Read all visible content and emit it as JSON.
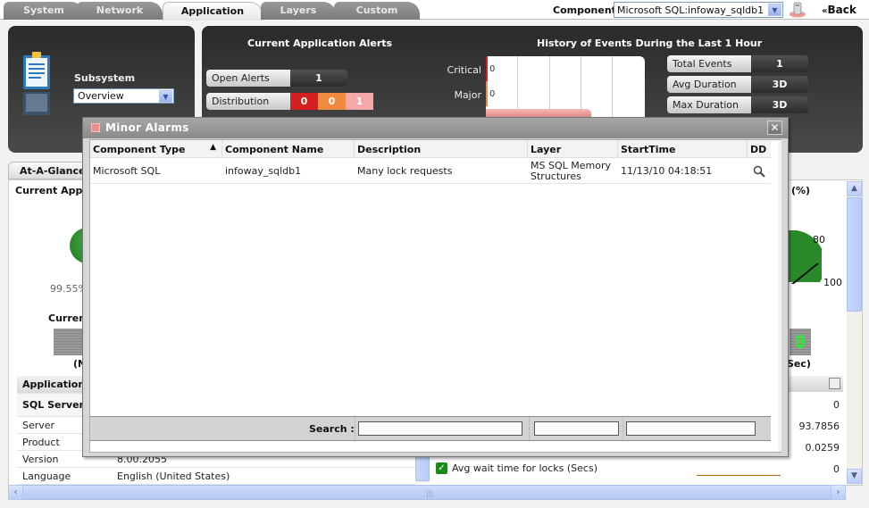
{
  "tabs": [
    {
      "label": "System",
      "active": false
    },
    {
      "label": "Network",
      "active": false
    },
    {
      "label": "Application",
      "active": true
    },
    {
      "label": "Layers",
      "active": false
    },
    {
      "label": "Custom",
      "active": false
    }
  ],
  "header": {
    "component_label": "Component",
    "component_value": "Microsoft SQL:infoway_sqldb1",
    "db_icon": "database-icon",
    "back_label": "Back",
    "back_icon": "double-chevron-left-icon"
  },
  "subsystem": {
    "icon": "clipboard-icon",
    "label": "Subsystem",
    "value": "Overview"
  },
  "alerts": {
    "title": "Current Application Alerts",
    "open_alerts_label": "Open Alerts",
    "open_alerts_value": "1",
    "distribution_label": "Distribution",
    "distribution": [
      {
        "severity": "Critical",
        "value": "0",
        "color": "#d42020"
      },
      {
        "severity": "Major",
        "value": "0",
        "color": "#f08a40"
      },
      {
        "severity": "Minor",
        "value": "1",
        "color": "#f5a8a8"
      }
    ]
  },
  "history": {
    "title": "History of Events During the Last 1 Hour",
    "rows": [
      {
        "label": "Critical",
        "value": "0"
      },
      {
        "label": "Major",
        "value": "0"
      }
    ],
    "stats": [
      {
        "label": "Total Events",
        "value": "1"
      },
      {
        "label": "Avg Duration",
        "value": "3D"
      },
      {
        "label": "Max Duration",
        "value": "3D"
      }
    ]
  },
  "glance": {
    "tab_label": "At-A-Glance",
    "current_app_label": "Current Appli",
    "availability_value": "99.55%",
    "current_label": "Current",
    "paren_left": "(N",
    "pct_label": "(%)",
    "gauge_80": "80",
    "gauge_100": "100",
    "led_value": "0",
    "sec_label": "Sec)"
  },
  "app_table": {
    "header": "Application",
    "subheader": "SQL Server",
    "rows": [
      {
        "key": "Server",
        "value": ""
      },
      {
        "key": "Product",
        "value": ""
      },
      {
        "key": "Version",
        "value": "8.00.2055"
      },
      {
        "key": "Language",
        "value": "English (United States)"
      }
    ]
  },
  "right_values": [
    "0",
    "93.7856",
    "0.0259",
    "0"
  ],
  "checked_metric": "Avg wait time for locks (Secs)",
  "modal": {
    "title": "Minor Alarms",
    "columns": [
      "Component Type",
      "Component Name",
      "Description",
      "Layer",
      "StartTime",
      "DD"
    ],
    "sort_indicator": "▲",
    "rows": [
      {
        "component_type": "Microsoft SQL",
        "component_name": "infoway_sqldb1",
        "description": "Many lock requests",
        "layer": "MS SQL Memory Structures",
        "start_time": "11/13/10 04:18:51",
        "dd_icon": "magnifier-icon"
      }
    ],
    "search_label": "Search :",
    "search_values": [
      "",
      "",
      ""
    ]
  }
}
